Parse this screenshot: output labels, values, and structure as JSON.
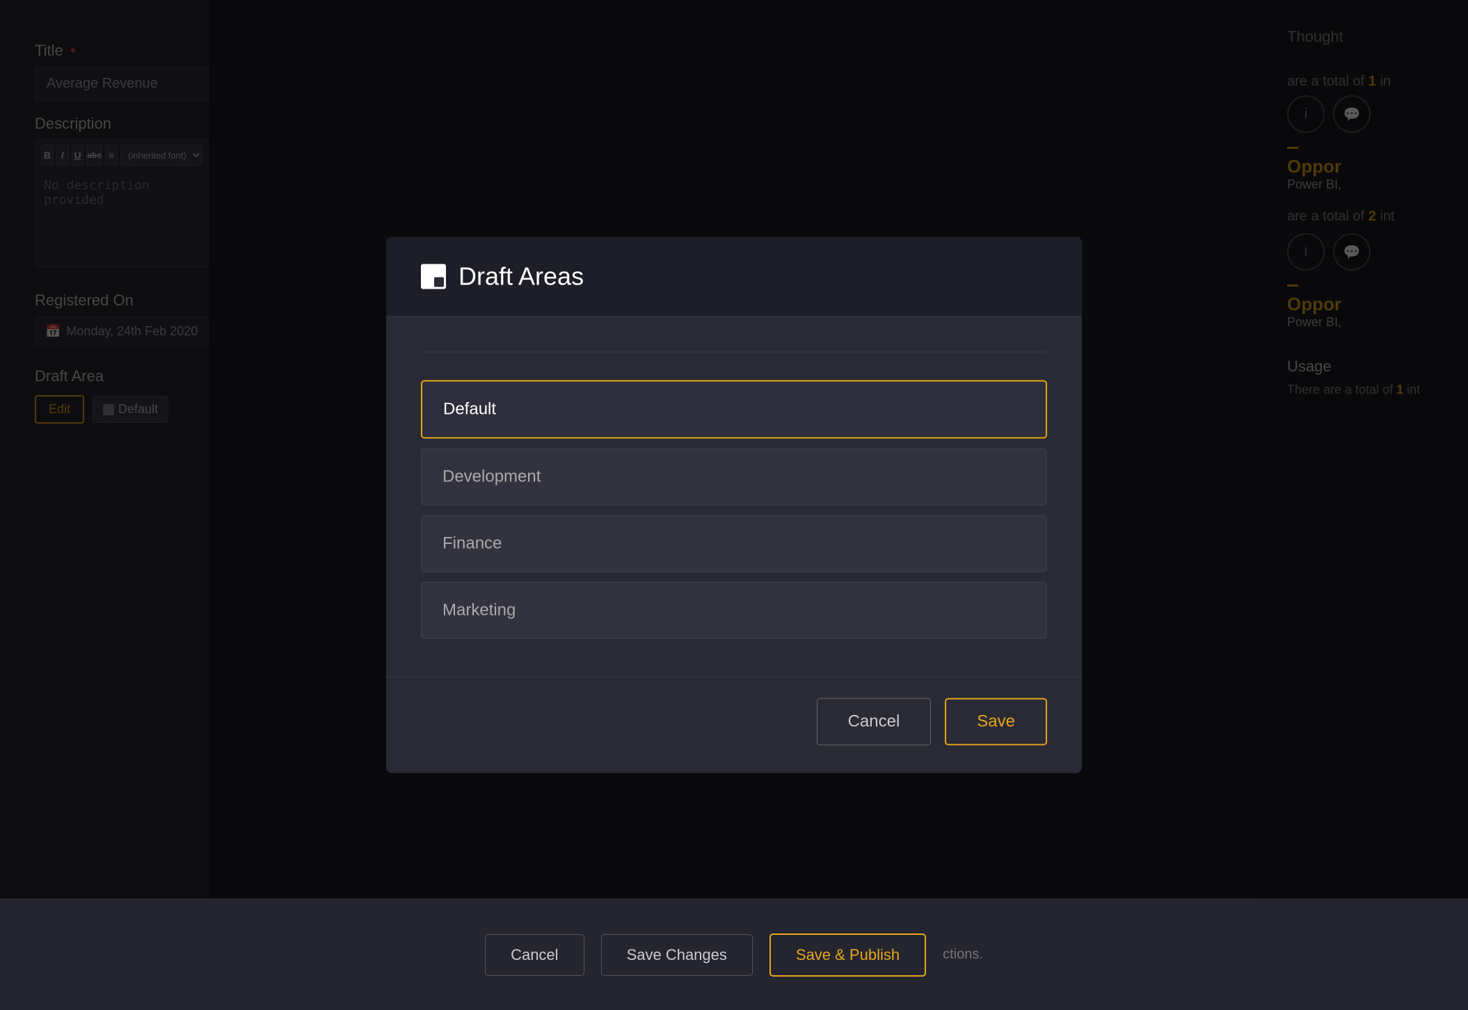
{
  "leftPanel": {
    "title_label": "Title",
    "title_required": "•",
    "title_value": "Average Revenue",
    "description_label": "Description",
    "desc_bold": "B",
    "desc_italic": "I",
    "desc_underline": "U",
    "desc_abc": "abc",
    "desc_align": "≡",
    "desc_font": "(inherited font)",
    "desc_placeholder": "No description provided",
    "registered_label": "Registered On",
    "registered_value": "Monday, 24th Feb 2020",
    "draft_area_label": "Draft Area",
    "edit_btn": "Edit",
    "default_badge": "Default"
  },
  "rightPanel": {
    "thought_text": "Thought",
    "total1": "are a total of",
    "total1_count": "1",
    "total1_suffix": "in",
    "total2": "are a total of",
    "total2_count": "2",
    "total2_suffix": "int",
    "opport_title": "Oppor",
    "powerbi_label": "Power BI,",
    "usage_title": "Usage",
    "usage_text": "There are a total of",
    "usage_count": "1",
    "usage_suffix": "int"
  },
  "bottomBar": {
    "cancel_label": "Cancel",
    "save_changes_label": "Save Changes",
    "publish_label": "Save & Publish",
    "actions_text": "ctions."
  },
  "modal": {
    "title": "Draft Areas",
    "areas": [
      {
        "name": "Default",
        "selected": true
      },
      {
        "name": "Development",
        "selected": false
      },
      {
        "name": "Finance",
        "selected": false
      },
      {
        "name": "Marketing",
        "selected": false
      }
    ],
    "cancel_label": "Cancel",
    "save_label": "Save"
  },
  "colors": {
    "accent": "#e6a817",
    "danger": "#e74c3c",
    "bg_dark": "#1e1e24",
    "bg_panel": "#252530",
    "text_muted": "#888888"
  }
}
